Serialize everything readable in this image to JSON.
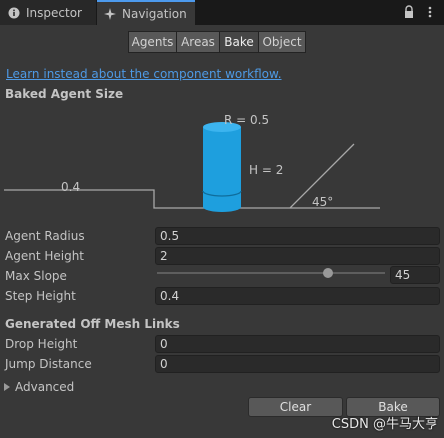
{
  "tabs": {
    "inspector": "Inspector",
    "navigation": "Navigation",
    "inspector_icon": "info-icon",
    "navigation_icon": "navigation-compass-icon",
    "right_icons": [
      "lock-icon",
      "more-options-icon"
    ]
  },
  "toolbar": {
    "items": [
      {
        "label": "Agents",
        "selected": false
      },
      {
        "label": "Areas",
        "selected": false
      },
      {
        "label": "Bake",
        "selected": true
      },
      {
        "label": "Object",
        "selected": false
      }
    ]
  },
  "link_text": "Learn instead about the component workflow.",
  "baked_agent_size": {
    "title": "Baked Agent Size",
    "radius_label": "R = 0.5",
    "height_label": "H = 2",
    "step_label": "0.4",
    "slope_label": "45°"
  },
  "settings": {
    "agent_radius": {
      "label": "Agent Radius",
      "value": "0.5"
    },
    "agent_height": {
      "label": "Agent Height",
      "value": "2"
    },
    "max_slope": {
      "label": "Max Slope",
      "value": "45",
      "min": 0,
      "max": 60
    },
    "step_height": {
      "label": "Step Height",
      "value": "0.4"
    }
  },
  "off_mesh_links": {
    "title": "Generated Off Mesh Links",
    "drop_height": {
      "label": "Drop Height",
      "value": "0"
    },
    "jump_distance": {
      "label": "Jump Distance",
      "value": "0"
    }
  },
  "advanced": {
    "label": "Advanced",
    "expanded": false
  },
  "buttons": {
    "clear": "Clear",
    "bake": "Bake"
  },
  "watermark": "CSDN @牛马大亨",
  "colors": {
    "accent": "#4d9aed",
    "cylinder": "#1e9fde",
    "link": "#4e9ae5"
  }
}
